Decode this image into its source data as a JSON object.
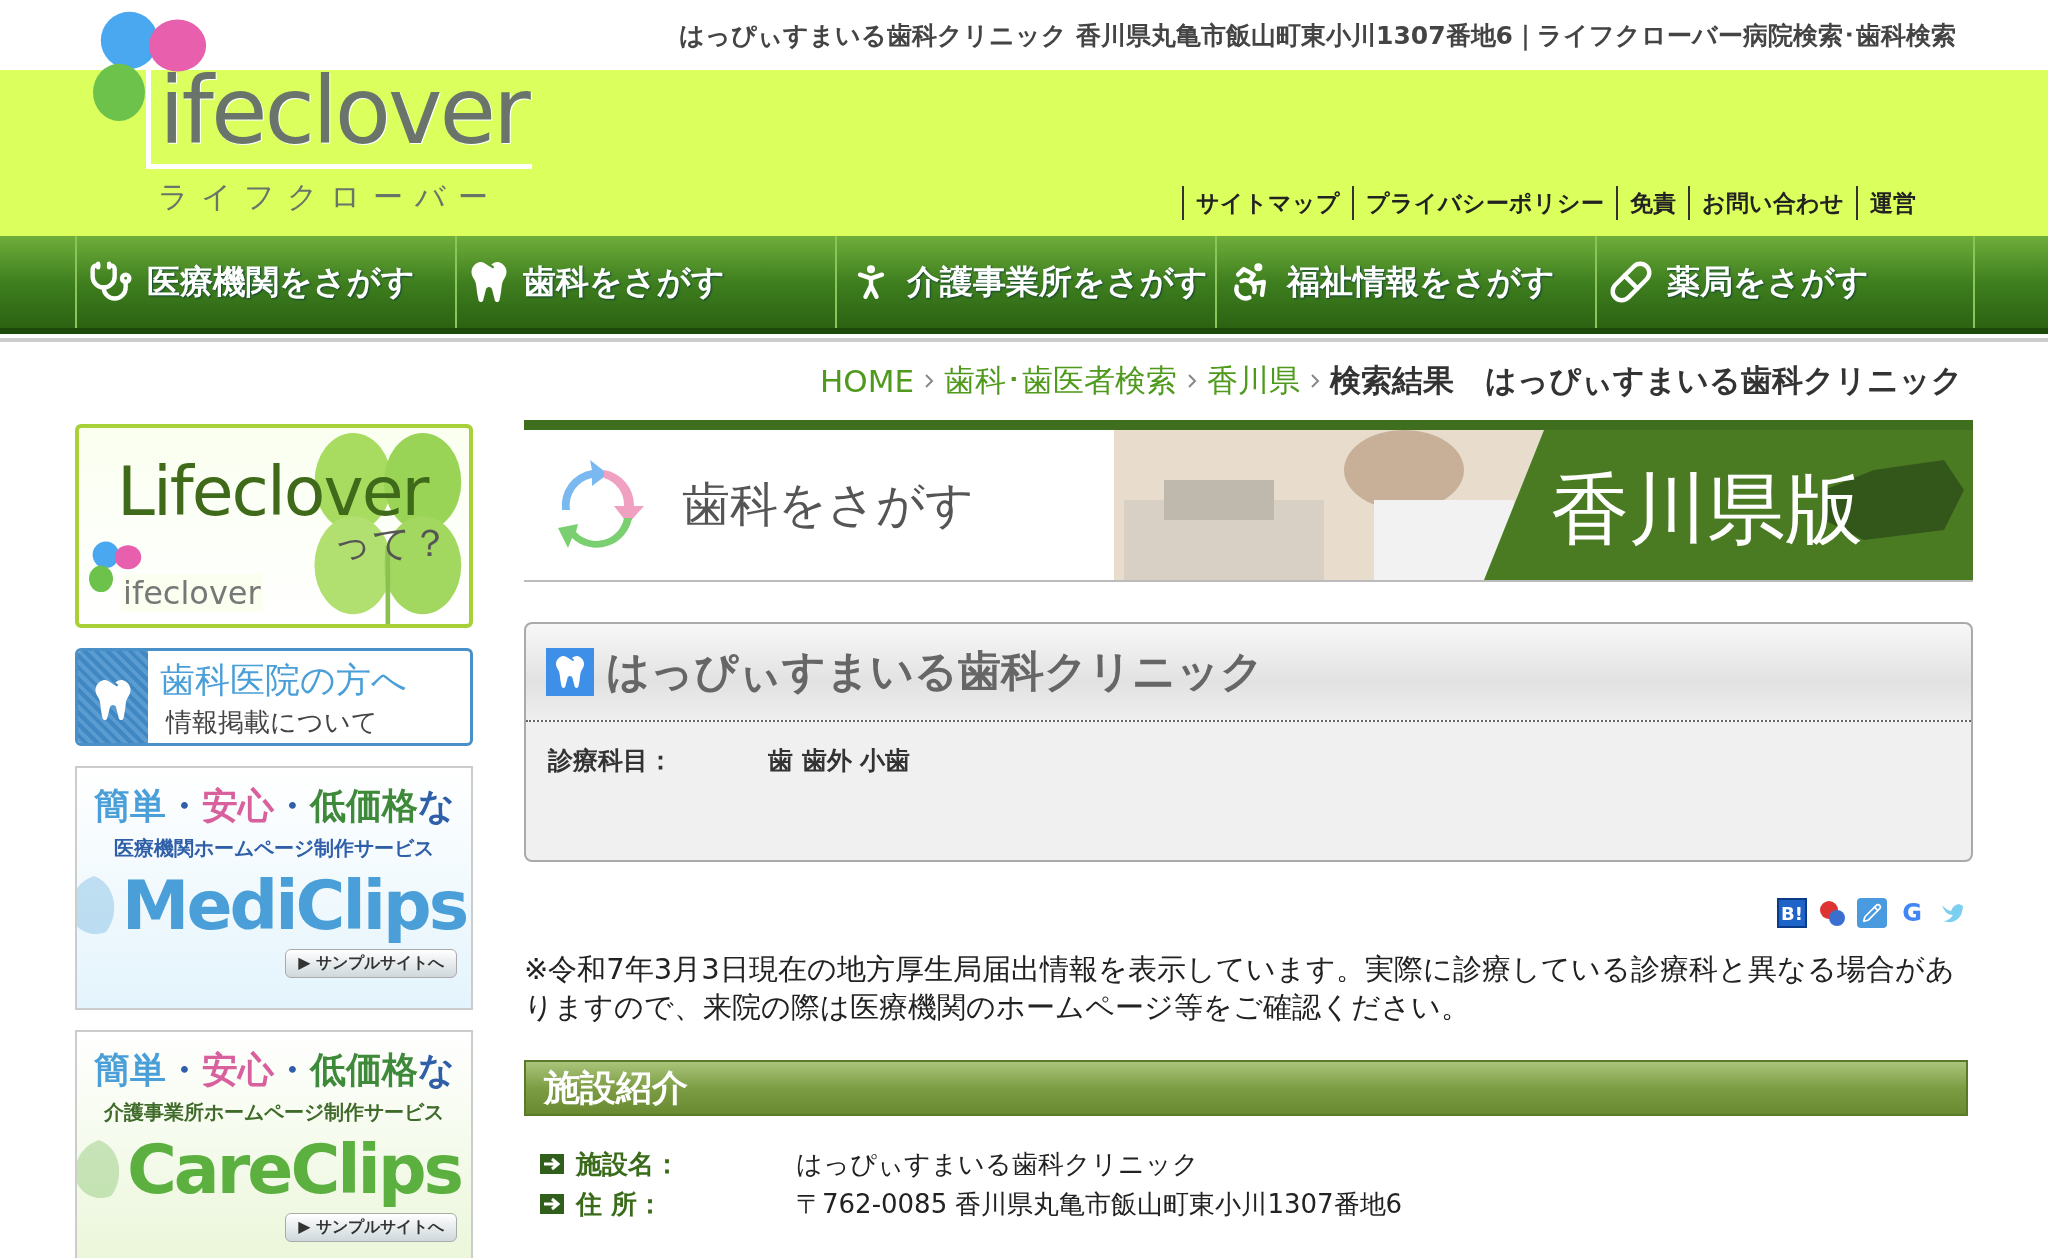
{
  "top_bar": {
    "text": "はっぴぃすまいる歯科クリニック 香川県丸亀市飯山町東小川1307番地6｜ライフクローバー病院検索･歯科検索"
  },
  "logo": {
    "wordmark": "ifeclover",
    "kana": "ライフクローバー"
  },
  "utility_links": [
    "サイトマップ",
    "プライバシーポリシー",
    "免責",
    "お問い合わせ",
    "運営"
  ],
  "nav": [
    {
      "kind": "stethoscope",
      "label": "医療機関をさがす"
    },
    {
      "kind": "tooth",
      "label": "歯科をさがす"
    },
    {
      "kind": "care",
      "label": "介護事業所をさがす"
    },
    {
      "kind": "wheelchair",
      "label": "福祉情報をさがす"
    },
    {
      "kind": "pill",
      "label": "薬局をさがす"
    }
  ],
  "breadcrumb": [
    {
      "label": "HOME",
      "link": true
    },
    {
      "label": "歯科･歯医者検索",
      "link": true
    },
    {
      "label": "香川県",
      "link": true
    },
    {
      "label": "検索結果　はっぴぃすまいる歯科クリニック",
      "link": false
    }
  ],
  "sidebar": [
    {
      "kind": "about",
      "title": "Lifeclover",
      "sub": "って？",
      "wordmark": "ifeclover"
    },
    {
      "kind": "dentist",
      "title": "歯科医院の方へ",
      "sub": "情報掲載について"
    },
    {
      "kind": "clips",
      "color": "#4a9fd8",
      "tagline": [
        {
          "text": "簡単",
          "color": "#4a9fd8"
        },
        {
          "text": "・",
          "color": "#2f5fa8"
        },
        {
          "text": "安心",
          "color": "#d8609c"
        },
        {
          "text": "・",
          "color": "#2f5fa8"
        },
        {
          "text": "低価格",
          "color": "#3f8a3a"
        },
        {
          "text": "な",
          "color": "#2f5fa8"
        }
      ],
      "service": "医療機関ホームページ制作サービス",
      "brand": "MediClips",
      "button": "▶ サンプルサイトへ"
    },
    {
      "kind": "clips",
      "color": "#5cb040",
      "tagline": [
        {
          "text": "簡単",
          "color": "#4a9fd8"
        },
        {
          "text": "・",
          "color": "#2f5fa8"
        },
        {
          "text": "安心",
          "color": "#d8609c"
        },
        {
          "text": "・",
          "color": "#2f5fa8"
        },
        {
          "text": "低価格",
          "color": "#3f8a3a"
        },
        {
          "text": "な",
          "color": "#2f5fa8"
        }
      ],
      "service": "介護事業所ホームページ制作サービス",
      "brand": "CareClips",
      "button": "▶ サンプルサイトへ"
    }
  ],
  "banner": {
    "title": "歯科をさがす",
    "region": "香川県版"
  },
  "clinic": {
    "name": "はっぴぃすまいる歯科クリニック",
    "fields": [
      {
        "label": "診療科目：",
        "value": "歯 歯外 小歯"
      }
    ]
  },
  "share_buttons": [
    {
      "kind": "hatena",
      "label": "B!"
    },
    {
      "kind": "bookmark"
    },
    {
      "kind": "pencil"
    },
    {
      "kind": "google",
      "label": "G"
    },
    {
      "kind": "bird"
    }
  ],
  "notice": "※令和7年3月3日現在の地方厚生局届出情報を表示しています。実際に診療している診療科と異なる場合がありますので、来院の際は医療機関のホームページ等をご確認ください。",
  "section": {
    "title": "施設紹介",
    "rows": [
      {
        "label": "施設名：",
        "value": "はっぴぃすまいる歯科クリニック"
      },
      {
        "label": "住 所：",
        "value": "〒762-0085 香川県丸亀市飯山町東小川1307番地6"
      }
    ]
  }
}
